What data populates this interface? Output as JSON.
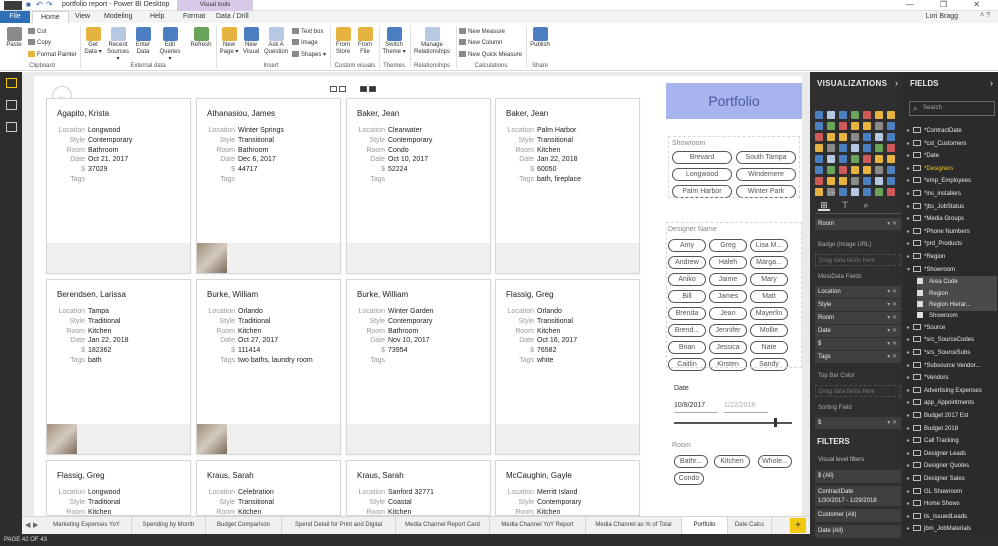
{
  "window": {
    "title": "portfolio report - Power BI Desktop",
    "context_tab_group": "Visual tools",
    "controls": "— ❐ ✕",
    "user": "Lori Bragg",
    "user_controls": "˄ ?"
  },
  "ribbon_tabs": [
    "File",
    "Home",
    "View",
    "Modeling",
    "Help",
    "Format",
    "Data / Drill"
  ],
  "ribbon": {
    "paste": "Paste",
    "cut": "Cut",
    "copy": "Copy",
    "format_painter": "Format Painter",
    "get_data": "Get Data ▾",
    "recent_sources": "Recent Sources ▾",
    "enter_data": "Enter Data",
    "edit_queries": "Edit Queries ▾",
    "refresh": "Refresh",
    "new_page": "New Page ▾",
    "new_visual": "New Visual",
    "ask_question": "Ask A Question",
    "text_box": "Text box",
    "image": "Image",
    "shapes": "Shapes ▾",
    "from_store": "From Store",
    "from_file": "From File",
    "switch_theme": "Switch Theme ▾",
    "manage_relationships": "Manage Relationships",
    "new_measure": "New Measure",
    "new_column": "New Column",
    "new_quick_measure": "New Quick Measure",
    "publish": "Publish",
    "groups": {
      "clipboard": "Clipboard",
      "external_data": "External data",
      "insert": "Insert",
      "custom_visuals": "Custom visuals",
      "themes": "Themes",
      "relationships": "Relationships",
      "calculations": "Calculations",
      "share": "Share"
    }
  },
  "labels": {
    "location": "Location",
    "style": "Style",
    "room": "Room",
    "date": "Date",
    "dollar": "$",
    "tags": "Tags"
  },
  "cards": [
    {
      "name": "Agapito, Krista",
      "location": "Longwood",
      "style": "Contemporary",
      "room": "Bathroom",
      "date": "Oct 21, 2017",
      "amount": "37029",
      "tags": "",
      "photo": false
    },
    {
      "name": "Athanasiou, James",
      "location": "Winter Springs",
      "style": "Transitional",
      "room": "Bathroom",
      "date": "Dec 6, 2017",
      "amount": "44717",
      "tags": "",
      "photo": true
    },
    {
      "name": "Baker, Jean",
      "location": "Clearwater",
      "style": "Contemporary",
      "room": "Condo",
      "date": "Oct 10, 2017",
      "amount": "52224",
      "tags": "",
      "photo": false
    },
    {
      "name": "Baker, Jean",
      "location": "Palm Harbor",
      "style": "Transitional",
      "room": "Kitchen",
      "date": "Jan 22, 2018",
      "amount": "60050",
      "tags": "bath, fireplace",
      "photo": false
    },
    {
      "name": "Berendsen, Larissa",
      "location": "Tampa",
      "style": "Traditional",
      "room": "Kitchen",
      "date": "Jan 22, 2018",
      "amount": "182362",
      "tags": "bath",
      "photo": true
    },
    {
      "name": "Burke, William",
      "location": "Orlando",
      "style": "Traditional",
      "room": "Kitchen",
      "date": "Oct 27, 2017",
      "amount": "111414",
      "tags": "two baths, laundry room",
      "photo": true
    },
    {
      "name": "Burke, William",
      "location": "Winter Garden",
      "style": "Contemporary",
      "room": "Bathroom",
      "date": "Nov 10, 2017",
      "amount": "73954",
      "tags": "",
      "photo": false
    },
    {
      "name": "Flassig, Greg",
      "location": "Orlando",
      "style": "Transitional",
      "room": "Kitchen",
      "date": "Oct 16, 2017",
      "amount": "76582",
      "tags": "white",
      "photo": false
    },
    {
      "name": "Flassig, Greg",
      "location": "Longwood",
      "style": "Traditional",
      "room": "Kitchen",
      "date": "",
      "amount": "",
      "tags": "",
      "photo": false
    },
    {
      "name": "Kraus, Sarah",
      "location": "Celebration",
      "style": "Transitional",
      "room": "Kitchen",
      "date": "",
      "amount": "",
      "tags": "",
      "photo": false
    },
    {
      "name": "Kraus, Sarah",
      "location": "Sanford 32771",
      "style": "Coastal",
      "room": "Kitchen",
      "date": "",
      "amount": "",
      "tags": "",
      "photo": false
    },
    {
      "name": "McCaughin, Gayle",
      "location": "Merritt Island",
      "style": "Contemporary",
      "room": "Kitchen",
      "date": "",
      "amount": "",
      "tags": "",
      "photo": false
    }
  ],
  "report_header": "Portfolio",
  "showroom_slicer": {
    "title": "Showroom",
    "items": [
      "Brevard",
      "South Tampa",
      "Longwood",
      "Windemere",
      "Palm Harbor",
      "Winter Park"
    ]
  },
  "designer_slicer": {
    "title": "Designer Name",
    "items": [
      "Amy",
      "Greg",
      "Lisa M...",
      "Andrew",
      "Haleh",
      "Marga...",
      "Aniko",
      "Jaime",
      "Mary",
      "Bill",
      "James",
      "Matt",
      "Brenda",
      "Jean",
      "Mayerlin",
      "Brend...",
      "Jennifer",
      "Mollie",
      "Brian",
      "Jessica",
      "Nate",
      "Caitlin",
      "Kirsten",
      "Sandy"
    ]
  },
  "date_slicer": {
    "title": "Date",
    "start": "10/8/2017",
    "end": "1/22/2018"
  },
  "room_slicer": {
    "title": "Room",
    "items": [
      "Bathr...",
      "Kitchen",
      "Whole...",
      "Condo"
    ]
  },
  "page_tabs": [
    "Marketing Expenses YoY",
    "Spending by Month",
    "Budget Comparison",
    "Spend Detail for Print and Digital",
    "Media Channel Report Card",
    "Media Channel YoY Report",
    "Media Channel as % of Total",
    "Portfolio",
    "Date Calcs"
  ],
  "add_page": "+",
  "status": "PAGE 42 OF 43",
  "visualizations": {
    "title": "VISUALIZATIONS",
    "more": "...",
    "wells": {
      "room_field": "Room",
      "badge_label": "Badge (Image URL)",
      "drop_here": "Drag data fields here",
      "metadata_label": "MetaData Fields",
      "meta_fields": [
        "Location",
        "Style",
        "Room",
        "Date",
        "$",
        "Tags"
      ],
      "topbar_label": "Top Bar Color",
      "sorting_label": "Sorting Field",
      "sorting_value": "$"
    },
    "filters_title": "FILTERS",
    "visual_level": "Visual level filters",
    "filters": [
      "$ (All)",
      "ContractDate\n1/30/2017 - 1/29/2018",
      "Customer (All)",
      "Date (All)"
    ]
  },
  "fields": {
    "title": "FIELDS",
    "search_placeholder": "Search",
    "tables": [
      "*ContractDate",
      "*cst_Customers",
      "*Date",
      "*Designers",
      "*emp_Employees",
      "*ins_installers",
      "*jbs_JobStatus",
      "*Media Groups",
      "*Phone Numbers",
      "*prd_Products",
      "*Region",
      "*Showroom"
    ],
    "showroom_children": [
      "Area Code",
      "Region",
      "Region Hierar...",
      "Showroom"
    ],
    "tables2": [
      "*Source",
      "*src_SourceCodes",
      "*srs_SourceSubs",
      "*Subsource Vendor...",
      "*Vendors",
      "Advertising Expenses",
      "app_Appointments",
      "Budget 2017 Est",
      "Budget 2018",
      "Call Tracking",
      "Designer Leads",
      "Designer Quotes",
      "Designer Sales",
      "GL Showroom",
      "Home Shows",
      "ils_IssuedLeads",
      "jbm_JobMaterials"
    ]
  },
  "colors": {
    "accent": "#f2c811",
    "header_bg": "#a8b4ee",
    "header_text": "#4a5aa0",
    "pane_dark": "#2f2f2f"
  }
}
